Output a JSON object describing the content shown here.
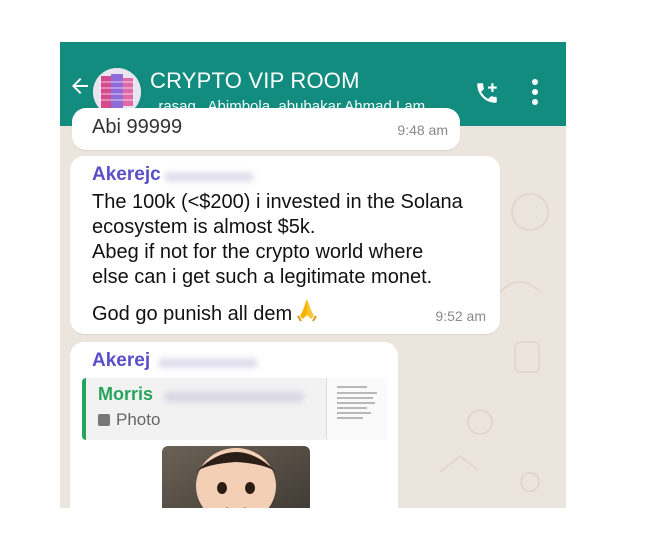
{
  "header": {
    "title": "CRYPTO VIP ROOM",
    "participants": ", rasaq , Abimbola, abubakar Ahmad Lam..."
  },
  "messages": {
    "previous": {
      "text_fragment": "Abi 99999",
      "time": "9:48 am"
    },
    "main": {
      "sender": "Akerejc",
      "lines": [
        "The 100k (<$200) i invested in the Solana",
        "ecosystem is almost $5k.",
        "Abeg if not for the crypto world where",
        "else can i get such a legitimate monet."
      ],
      "last_line": "God go punish all dem",
      "time": "9:52 am"
    },
    "reply": {
      "sender": "Akerej",
      "quoted_sender": "Morris",
      "quoted_type": "Photo"
    }
  },
  "colors": {
    "header_bg": "#128c7e",
    "chat_bg": "#ece5dd",
    "sender_name": "#5b4fc9",
    "quote_accent": "#25a45c"
  },
  "icons": {
    "back": "back-arrow-icon",
    "call": "add-call-icon",
    "menu": "more-vertical-icon",
    "photo": "photo-icon",
    "emoji": "folded-hands-emoji"
  }
}
